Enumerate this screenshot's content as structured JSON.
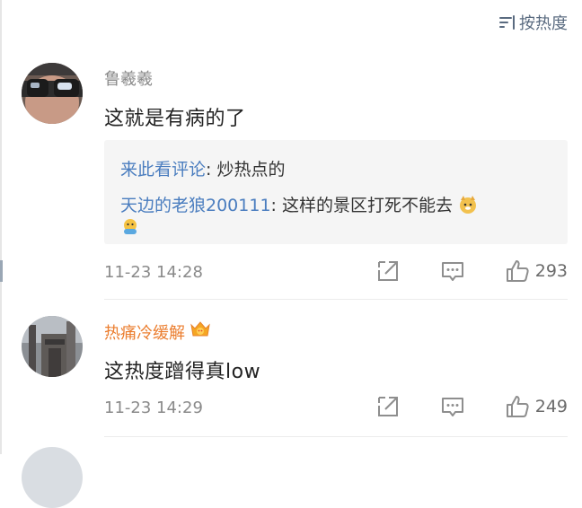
{
  "header": {
    "sort_label": "按热度",
    "sort_icon": "sort-lines-icon"
  },
  "comments": [
    {
      "username": "鲁羲羲",
      "content": "这就是有病的了",
      "replies": [
        {
          "user": "来此看评论",
          "text": ": 炒热点的"
        },
        {
          "user": "天边的老狼200111",
          "text": ": 这样的景区打死不能去"
        }
      ],
      "timestamp": "11-23 14:28",
      "likes": "293"
    },
    {
      "username": "热痛冷缓解",
      "content": "这热度蹭得真low",
      "timestamp": "11-23 14:29",
      "likes": "249"
    }
  ],
  "colors": {
    "link_blue": "#4a7dbf",
    "username_gray": "#8a8a8a",
    "username_orange": "#eb7d2e",
    "reply_bg": "#f5f5f5"
  },
  "icons": {
    "share": "share-icon",
    "reply": "comment-icon",
    "like": "thumbs-up-icon"
  }
}
